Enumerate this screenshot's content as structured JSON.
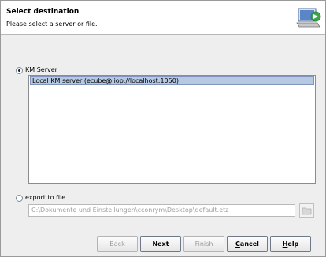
{
  "header": {
    "title": "Select destination",
    "subtitle": "Please select a server or file."
  },
  "km_server": {
    "label": "KM Server",
    "selected": true,
    "items": [
      "Local KM server (ecube@iiop://localhost:1050)"
    ]
  },
  "export": {
    "label": "export to file",
    "selected": false,
    "path": "C:\\Dokumente und Einstellungen\\cconrym\\Desktop\\default.etz"
  },
  "buttons": {
    "back": "Back",
    "next": "Next",
    "finish": "Finish",
    "cancel_prefix": "",
    "cancel_mn": "C",
    "cancel_rest": "ancel",
    "help_prefix": "",
    "help_mn": "H",
    "help_rest": "elp"
  }
}
